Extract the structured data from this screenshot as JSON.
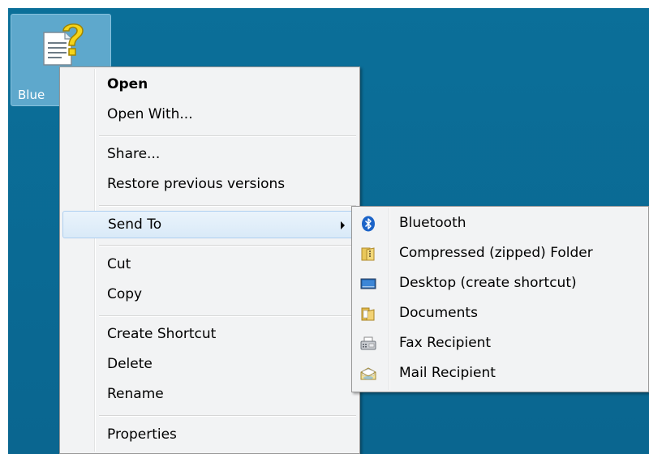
{
  "desktop": {
    "icon": {
      "label": "Blue",
      "icon": "help-document-icon"
    },
    "colors": {
      "background": "#0a6a93",
      "selection": "#5ea8cc"
    }
  },
  "context_menu": {
    "items": [
      {
        "label": "Open",
        "bold": true
      },
      {
        "label": "Open With..."
      },
      {
        "label": "Share..."
      },
      {
        "label": "Restore previous versions"
      },
      {
        "label": "Send To",
        "submenu": true,
        "highlighted": true
      },
      {
        "label": "Cut"
      },
      {
        "label": "Copy"
      },
      {
        "label": "Create Shortcut"
      },
      {
        "label": "Delete"
      },
      {
        "label": "Rename"
      },
      {
        "label": "Properties"
      }
    ]
  },
  "send_to_menu": {
    "items": [
      {
        "label": "Bluetooth",
        "icon": "bluetooth-icon"
      },
      {
        "label": "Compressed (zipped) Folder",
        "icon": "zip-folder-icon"
      },
      {
        "label": "Desktop (create shortcut)",
        "icon": "desktop-icon"
      },
      {
        "label": "Documents",
        "icon": "documents-folder-icon"
      },
      {
        "label": "Fax Recipient",
        "icon": "fax-icon"
      },
      {
        "label": "Mail Recipient",
        "icon": "mail-icon"
      }
    ]
  }
}
